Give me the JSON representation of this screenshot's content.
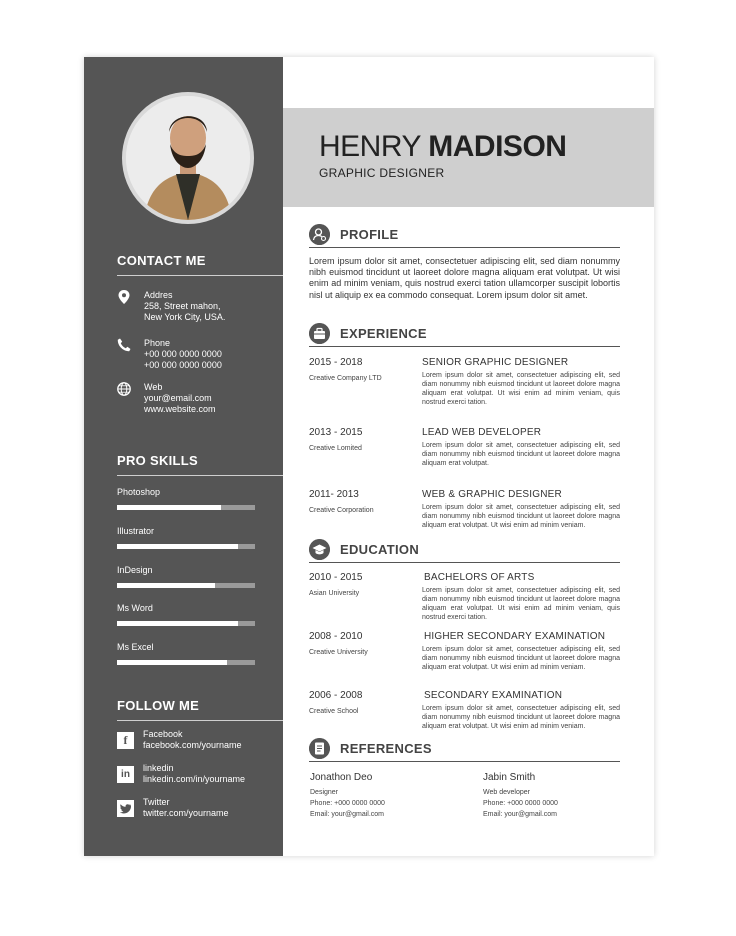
{
  "header": {
    "first_name": "HENRY",
    "last_name": "MADISON",
    "title": "GRAPHIC DESIGNER"
  },
  "contact": {
    "heading": "CONTACT ME",
    "address_label": "Addres",
    "address_lines": [
      "258, Street mahon,",
      "New York City, USA."
    ],
    "phone_label": "Phone",
    "phone_lines": [
      "+00 000 0000 0000",
      "+00 000 0000 0000"
    ],
    "web_label": "Web",
    "web_lines": [
      "your@email.com",
      "www.website.com"
    ]
  },
  "skills": {
    "heading": "PRO SKILLS",
    "items": [
      {
        "label": "Photoshop",
        "level": 0.75
      },
      {
        "label": "Illustrator",
        "level": 0.88
      },
      {
        "label": "InDesign",
        "level": 0.71
      },
      {
        "label": "Ms Word",
        "level": 0.88
      },
      {
        "label": "Ms Excel",
        "level": 0.8
      }
    ]
  },
  "follow": {
    "heading": "FOLLOW ME",
    "items": [
      {
        "network": "Facebook",
        "handle": "facebook.com/yourname",
        "icon": "facebook-icon"
      },
      {
        "network": "linkedin",
        "handle": "linkedin.com/in/yourname",
        "icon": "linkedin-icon"
      },
      {
        "network": "Twitter",
        "handle": "twitter.com/yourname",
        "icon": "twitter-icon"
      }
    ]
  },
  "profile": {
    "heading": "PROFILE",
    "text": "Lorem ipsum dolor sit amet, consectetuer adipiscing elit, sed diam nonummy nibh euismod tincidunt ut laoreet dolore magna aliquam erat volutpat. Ut wisi enim ad minim veniam, quis nostrud exerci tation ullamcorper suscipit lobortis nisl ut aliquip ex ea commodo consequat. Lorem ipsum dolor sit amet."
  },
  "experience": {
    "heading": "EXPERIENCE",
    "items": [
      {
        "years": "2015 - 2018",
        "org": "Creative Company LTD",
        "title": "SENIOR GRAPHIC DESIGNER",
        "desc": "Lorem ipsum dolor sit amet, consectetuer adipiscing elit, sed diam nonummy nibh euismod tincidunt ut laoreet dolore magna aliquam erat volutpat. Ut wisi enim ad minim veniam, quis nostrud exerci tation."
      },
      {
        "years": "2013 - 2015",
        "org": "Creative Lomited",
        "title": "LEAD WEB DEVELOPER",
        "desc": "Lorem ipsum dolor sit amet, consectetuer adipiscing elit, sed diam nonummy nibh euismod tincidunt ut laoreet dolore magna aliquam erat volutpat."
      },
      {
        "years": "2011- 2013",
        "org": "Creative Corporation",
        "title": "WEB & GRAPHIC DESIGNER",
        "desc": "Lorem ipsum dolor sit amet, consectetuer adipiscing elit, sed diam nonummy nibh euismod tincidunt ut laoreet dolore magna aliquam erat volutpat. Ut wisi enim ad minim veniam."
      }
    ]
  },
  "education": {
    "heading": "EDUCATION",
    "items": [
      {
        "years": "2010 - 2015",
        "org": "Asian University",
        "title": "BACHELORS OF ARTS",
        "desc": "Lorem ipsum dolor sit amet, consectetuer adipiscing elit, sed diam nonummy nibh euismod tincidunt ut laoreet dolore magna aliquam erat volutpat. Ut wisi enim ad minim veniam, quis nostrud exerci tation."
      },
      {
        "years": "2008 - 2010",
        "org": "Creative University",
        "title": "HIGHER SECONDARY EXAMINATION",
        "desc": "Lorem ipsum dolor sit amet, consectetuer adipiscing elit, sed diam nonummy nibh euismod tincidunt ut laoreet dolore magna aliquam erat volutpat. Ut wisi enim ad minim veniam."
      },
      {
        "years": "2006 - 2008",
        "org": "Creative School",
        "title": "SECONDARY EXAMINATION",
        "desc": "Lorem ipsum dolor sit amet, consectetuer adipiscing elit, sed diam nonummy nibh euismod tincidunt ut laoreet dolore magna aliquam erat volutpat. Ut wisi enim ad minim veniam."
      }
    ]
  },
  "references": {
    "heading": "REFERENCES",
    "items": [
      {
        "name": "Jonathon Deo",
        "role": "Designer",
        "phone": "Phone: +000 0000 0000",
        "email": "Email: your@gmail.com"
      },
      {
        "name": "Jabin Smith",
        "role": "Web developer",
        "phone": "Phone: +000 0000 0000",
        "email": "Email: your@gmail.com"
      }
    ]
  },
  "colors": {
    "sidebar": "#555555",
    "header_band": "#cfcfcf",
    "bar_track": "#9a9a9a"
  }
}
